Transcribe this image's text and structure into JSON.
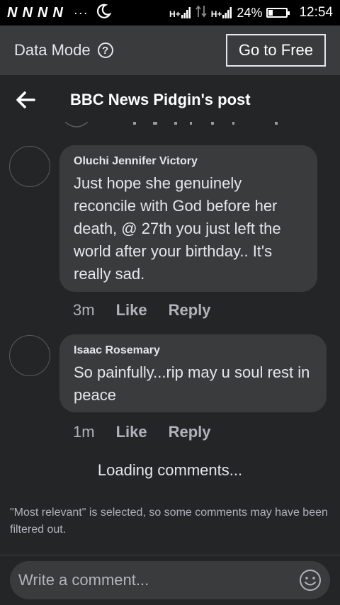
{
  "status_bar": {
    "carriers": [
      "N",
      "N",
      "N",
      "N"
    ],
    "dots": "···",
    "signal_1": "H+",
    "signal_2": "H+",
    "battery_percent": "24%",
    "battery_level": 0.24,
    "time": "12:54",
    "icons": [
      "moon-icon",
      "signal-icon",
      "data-arrows-icon",
      "signal-icon",
      "battery-icon"
    ]
  },
  "data_bar": {
    "label": "Data Mode",
    "help_icon": "?",
    "go_free_label": "Go to Free"
  },
  "header": {
    "title": "BBC News Pidgin's post",
    "back_icon": "arrow-left-icon"
  },
  "comments": [
    {
      "author": "Oluchi Jennifer Victory",
      "text": "Just hope she genuinely reconcile with God before her death, @ 27th  you just left the world after your birthday.. It's really sad.",
      "time": "3m",
      "like_label": "Like",
      "reply_label": "Reply"
    },
    {
      "author": "Isaac Rosemary",
      "text": "So painfully...rip may u soul rest in peace",
      "time": "1m",
      "like_label": "Like",
      "reply_label": "Reply"
    }
  ],
  "loading_text": "Loading comments...",
  "filter_note": "\"Most relevant\" is selected, so some comments may have been filtered out.",
  "composer": {
    "placeholder": "Write a comment...",
    "emoji_icon": "smiley-icon"
  },
  "colors": {
    "background": "#242527",
    "bubble": "#3a3b3c",
    "text": "#e4e6eb",
    "muted": "#b0b3b8"
  }
}
